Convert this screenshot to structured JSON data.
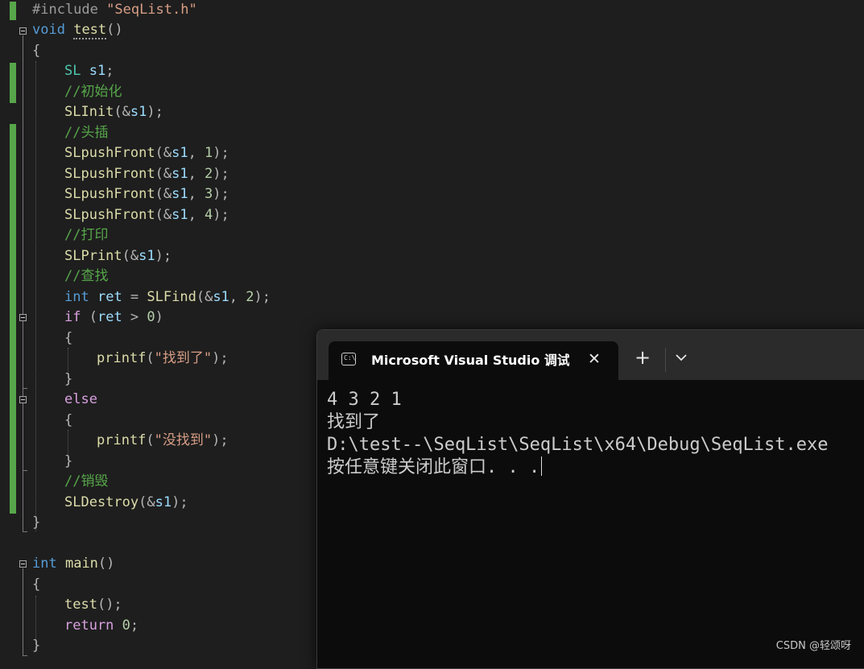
{
  "editor": {
    "lines": {
      "l01": {
        "a": "#include ",
        "b": "\"SeqList.h\""
      },
      "l02": {
        "a": "void",
        "b": " ",
        "c": "test",
        "d": "()"
      },
      "l03": {
        "a": "{"
      },
      "l04": {
        "a": "SL",
        "b": " ",
        "c": "s1",
        "d": ";"
      },
      "l05": {
        "a": "//初始化"
      },
      "l06": {
        "a": "SLInit",
        "b": "(&",
        "c": "s1",
        "d": ");"
      },
      "l07": {
        "a": "//头插"
      },
      "l08": {
        "a": "SLpushFront",
        "b": "(&",
        "c": "s1",
        "d": ", ",
        "e": "1",
        "f": ");"
      },
      "l09": {
        "a": "SLpushFront",
        "b": "(&",
        "c": "s1",
        "d": ", ",
        "e": "2",
        "f": ");"
      },
      "l10": {
        "a": "SLpushFront",
        "b": "(&",
        "c": "s1",
        "d": ", ",
        "e": "3",
        "f": ");"
      },
      "l11": {
        "a": "SLpushFront",
        "b": "(&",
        "c": "s1",
        "d": ", ",
        "e": "4",
        "f": ");"
      },
      "l12": {
        "a": "//打印"
      },
      "l13": {
        "a": "SLPrint",
        "b": "(&",
        "c": "s1",
        "d": ");"
      },
      "l14": {
        "a": "//查找"
      },
      "l15": {
        "a": "int",
        "b": " ",
        "c": "ret",
        "d": " = ",
        "e": "SLFind",
        "f": "(&",
        "g": "s1",
        "h": ", ",
        "i": "2",
        "j": ");"
      },
      "l16": {
        "a": "if",
        "b": " (",
        "c": "ret",
        "d": " > ",
        "e": "0",
        "f": ")"
      },
      "l17": {
        "a": "{"
      },
      "l18": {
        "a": "printf",
        "b": "(",
        "c": "\"找到了\"",
        "d": ");"
      },
      "l19": {
        "a": "}"
      },
      "l20": {
        "a": "else"
      },
      "l21": {
        "a": "{"
      },
      "l22": {
        "a": "printf",
        "b": "(",
        "c": "\"没找到\"",
        "d": ");"
      },
      "l23": {
        "a": "}"
      },
      "l24": {
        "a": "//销毁"
      },
      "l25": {
        "a": "SLDestroy",
        "b": "(&",
        "c": "s1",
        "d": ");"
      },
      "l26": {
        "a": "}"
      },
      "l28": {
        "a": "int",
        "b": " ",
        "c": "main",
        "d": "()"
      },
      "l29": {
        "a": "{"
      },
      "l30": {
        "a": "test",
        "b": "();"
      },
      "l31": {
        "a": "return",
        "b": " ",
        "c": "0",
        "d": ";"
      },
      "l32": {
        "a": "}"
      }
    }
  },
  "terminal": {
    "tab_title": "Microsoft Visual Studio 调试控制台",
    "tab_icon_text": "C:\\",
    "close_glyph": "✕",
    "new_tab_glyph": "+",
    "output": [
      "4 3 2 1",
      "找到了",
      "D:\\test--\\SeqList\\SeqList\\x64\\Debug\\SeqList.exe",
      "按任意键关闭此窗口. . ."
    ]
  },
  "watermark": "CSDN @轻颂呀",
  "colors": {
    "editor_bg": "#1e1e1e",
    "keyword": "#569cd6",
    "comment": "#57a64a",
    "string": "#d69d85",
    "function": "#dcdcaa",
    "change_bar": "#57a64a",
    "terminal_bg": "#0c0c0c"
  }
}
